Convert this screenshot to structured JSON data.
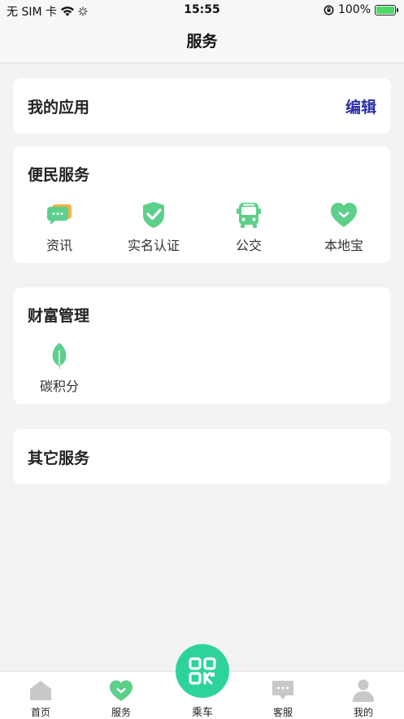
{
  "status_bar": {
    "carrier": "无 SIM 卡",
    "time": "15:55",
    "battery": "100%"
  },
  "header": {
    "title": "服务"
  },
  "my_apps": {
    "title": "我的应用",
    "edit_label": "编辑"
  },
  "convenience": {
    "title": "便民服务",
    "items": [
      {
        "label": "资讯",
        "icon": "chat-bubbles-icon"
      },
      {
        "label": "实名认证",
        "icon": "shield-check-icon"
      },
      {
        "label": "公交",
        "icon": "bus-icon"
      },
      {
        "label": "本地宝",
        "icon": "heart-icon"
      }
    ]
  },
  "wealth": {
    "title": "财富管理",
    "items": [
      {
        "label": "碳积分",
        "icon": "leaf-icon"
      }
    ]
  },
  "other": {
    "title": "其它服务"
  },
  "tabbar": {
    "items": [
      {
        "label": "首页",
        "icon": "home-icon"
      },
      {
        "label": "服务",
        "icon": "heart-icon"
      },
      {
        "label": "乘车",
        "icon": "qr-code-icon"
      },
      {
        "label": "客服",
        "icon": "chat-icon"
      },
      {
        "label": "我的",
        "icon": "user-icon"
      }
    ]
  },
  "colors": {
    "accent": "#2ed39a",
    "icon_green": "#5ccf8a",
    "edit_link": "#2b2fa6",
    "tab_inactive": "#c8c8c8"
  }
}
